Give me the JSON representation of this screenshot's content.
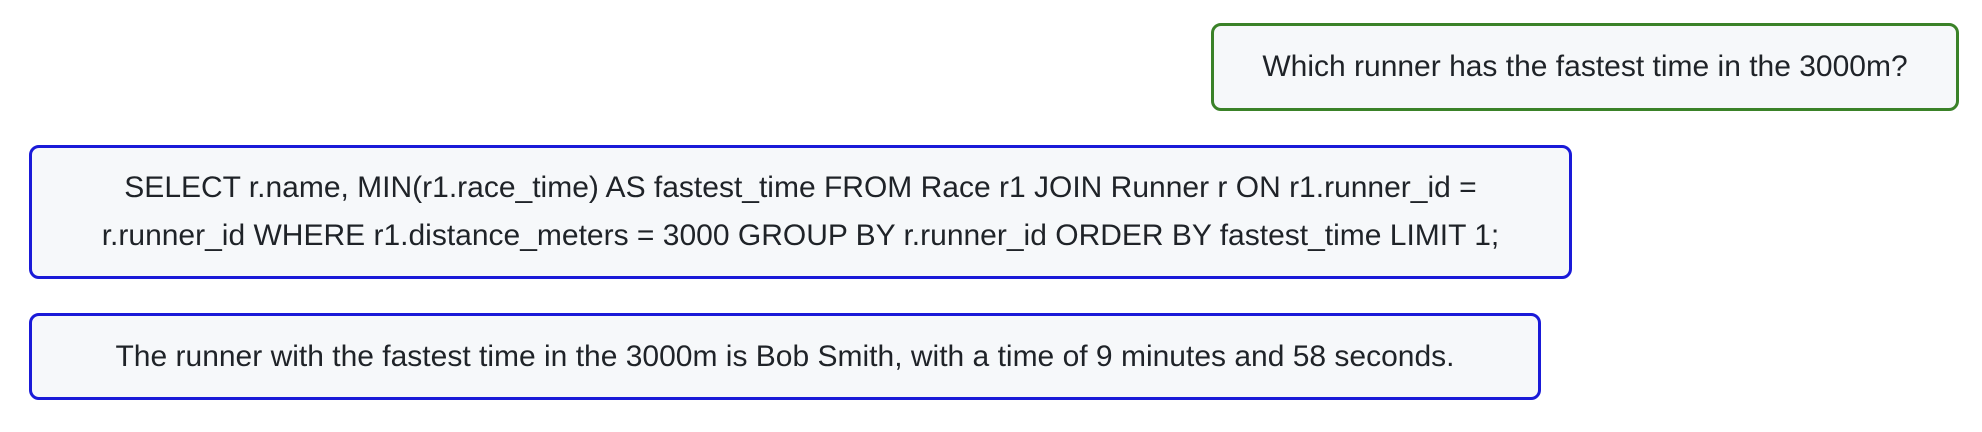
{
  "conversation": {
    "user_question": "Which runner has the fastest time in the 3000m?",
    "sql_query": "SELECT r.name, MIN(r1.race_time) AS fastest_time FROM Race r1 JOIN Runner r ON r1.runner_id = r.runner_id WHERE r1.distance_meters = 3000 GROUP BY r.runner_id ORDER BY fastest_time LIMIT 1;",
    "answer": "The runner with the fastest time in the 3000m is Bob Smith, with a time of 9 minutes and 58 seconds."
  },
  "colors": {
    "user_border": "#3a8228",
    "assistant_border": "#1a1ad8",
    "bubble_background": "#f6f8fa"
  }
}
